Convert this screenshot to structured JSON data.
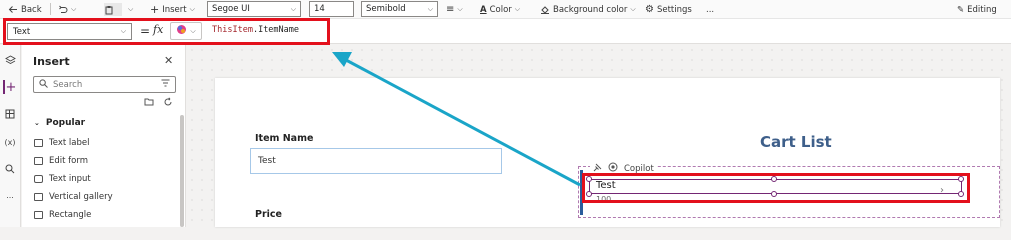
{
  "toolbar": {
    "back_label": "Back",
    "insert_label": "Insert",
    "font_family": "Segoe UI",
    "font_size": "14",
    "font_weight": "Semibold",
    "color_label": "Color",
    "background_color_label": "Background color",
    "settings_label": "Settings",
    "more_label": "...",
    "editing_label": "Editing"
  },
  "formula_bar": {
    "property": "Text",
    "equals": "=",
    "fx": "fx",
    "keyword": "ThisItem",
    "member": ".ItemName"
  },
  "rail": {
    "variables_label": "(x)",
    "more_label": "..."
  },
  "insert_panel": {
    "title": "Insert",
    "search_placeholder": "Search",
    "section": "Popular",
    "items": [
      {
        "label": "Text label"
      },
      {
        "label": "Edit form"
      },
      {
        "label": "Text input"
      },
      {
        "label": "Vertical gallery"
      },
      {
        "label": "Rectangle"
      }
    ]
  },
  "canvas": {
    "item_name_label": "Item Name",
    "item_name_value": "Test",
    "price_label": "Price",
    "cart_title": "Cart List",
    "copilot_label": "Copilot",
    "gallery_item_title": "Test",
    "gallery_item_sub": "100"
  },
  "colors": {
    "annotation_red": "#e3101c",
    "arrow_teal": "#1aa5c8",
    "cart_title": "#3e5f8a",
    "selection": "#742774"
  }
}
